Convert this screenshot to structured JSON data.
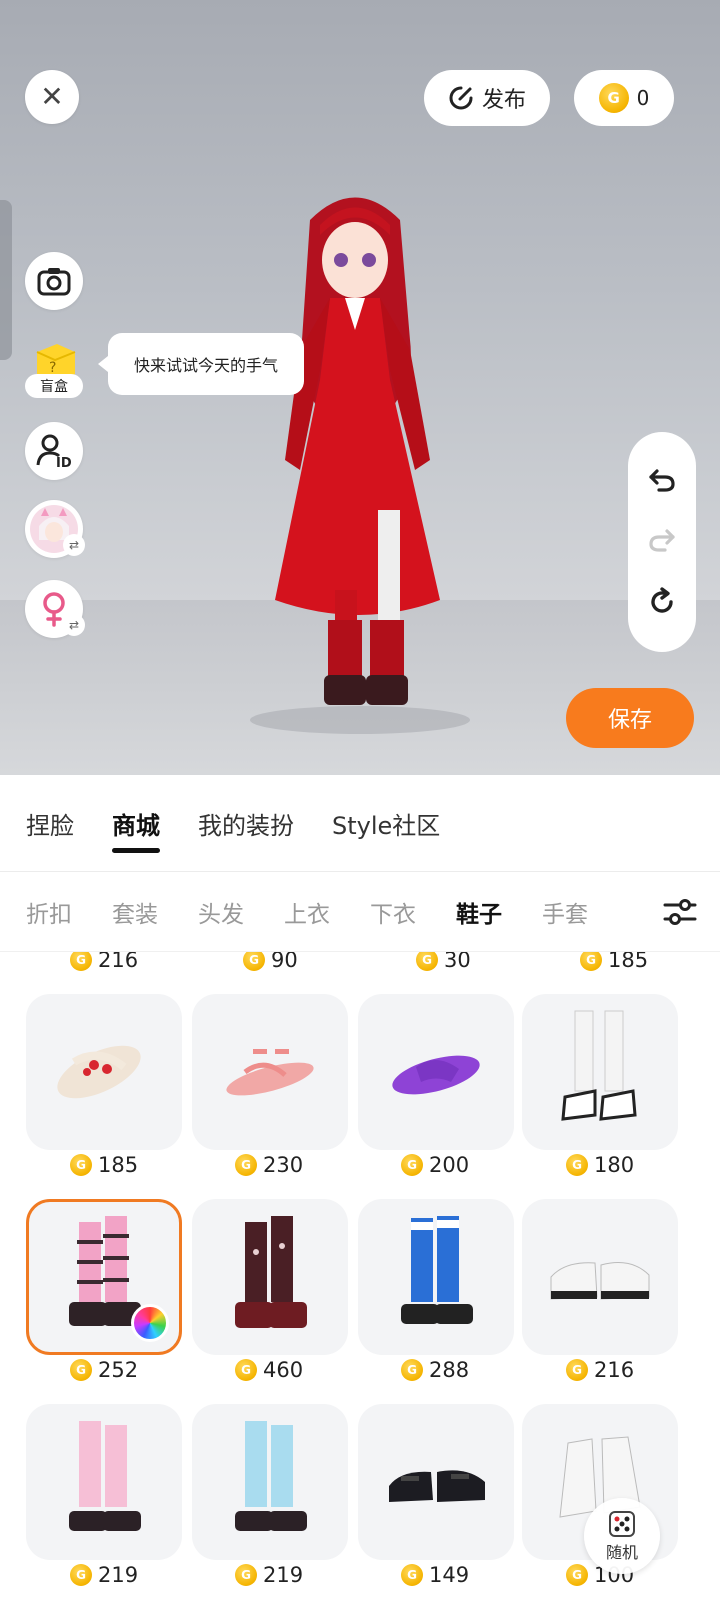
{
  "top_bar": {
    "publish_label": "发布",
    "coin_count": "0",
    "coin_glyph": "G"
  },
  "left_tools": {
    "blind_box_label": "盲盒",
    "blind_box_tip": "快来试试今天的手气"
  },
  "save_label": "保存",
  "main_tabs": [
    {
      "label": "捏脸",
      "active": false
    },
    {
      "label": "商城",
      "active": true
    },
    {
      "label": "我的装扮",
      "active": false
    },
    {
      "label": "Style社区",
      "active": false
    }
  ],
  "sub_tabs": [
    {
      "label": "折扣",
      "active": false
    },
    {
      "label": "套装",
      "active": false
    },
    {
      "label": "头发",
      "active": false
    },
    {
      "label": "上衣",
      "active": false
    },
    {
      "label": "下衣",
      "active": false
    },
    {
      "label": "鞋子",
      "active": true
    },
    {
      "label": "手套",
      "active": false
    }
  ],
  "top_prices": [
    "216",
    "90",
    "30",
    "185"
  ],
  "items": [
    {
      "name": "cream-flower-sandals",
      "price": "185",
      "selected": false
    },
    {
      "name": "pink-strap-sandals",
      "price": "230",
      "selected": false
    },
    {
      "name": "purple-slides",
      "price": "200",
      "selected": false
    },
    {
      "name": "white-socks-sneakers",
      "price": "180",
      "selected": false
    },
    {
      "name": "pink-platform-boots",
      "price": "252",
      "selected": true
    },
    {
      "name": "dark-red-platform-boots",
      "price": "460",
      "selected": false
    },
    {
      "name": "blue-leg-warmer-shoes",
      "price": "288",
      "selected": false
    },
    {
      "name": "white-chunky-sneakers",
      "price": "216",
      "selected": false
    },
    {
      "name": "pink-leg-warmer-boots",
      "price": "219",
      "selected": false
    },
    {
      "name": "light-blue-leg-warmer-boots",
      "price": "219",
      "selected": false
    },
    {
      "name": "black-loafers",
      "price": "149",
      "selected": false
    },
    {
      "name": "white-high-top-sneakers",
      "price": "100",
      "selected": false
    }
  ],
  "random_label": "随机",
  "colors": {
    "accent": "#f87b1d",
    "selected_border": "#f07a22",
    "coin": "#f5b400",
    "gender_icon": "#e85a8a"
  }
}
